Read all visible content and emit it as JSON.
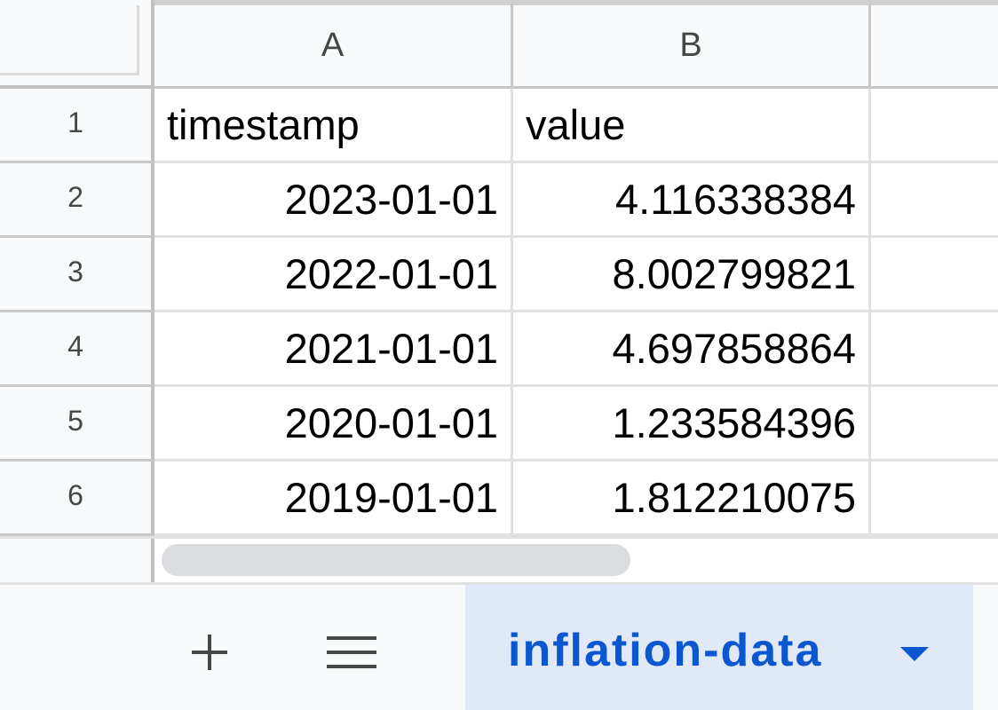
{
  "columns": [
    "A",
    "B"
  ],
  "rows": [
    {
      "num": "1",
      "a": "timestamp",
      "b": "value"
    },
    {
      "num": "2",
      "a": "2023-01-01",
      "b": "4.116338384"
    },
    {
      "num": "3",
      "a": "2022-01-01",
      "b": "8.002799821"
    },
    {
      "num": "4",
      "a": "2021-01-01",
      "b": "4.697858864"
    },
    {
      "num": "5",
      "a": "2020-01-01",
      "b": "1.233584396"
    },
    {
      "num": "6",
      "a": "2019-01-01",
      "b": "1.812210075"
    }
  ],
  "sheet_bar": {
    "add_icon": "plus-icon",
    "list_icon": "menu-icon",
    "active_tab": "inflation-data",
    "tab_menu_icon": "caret-down-icon"
  },
  "colors": {
    "tab_accent": "#0b57d0",
    "tab_background": "#e1e9f7"
  }
}
